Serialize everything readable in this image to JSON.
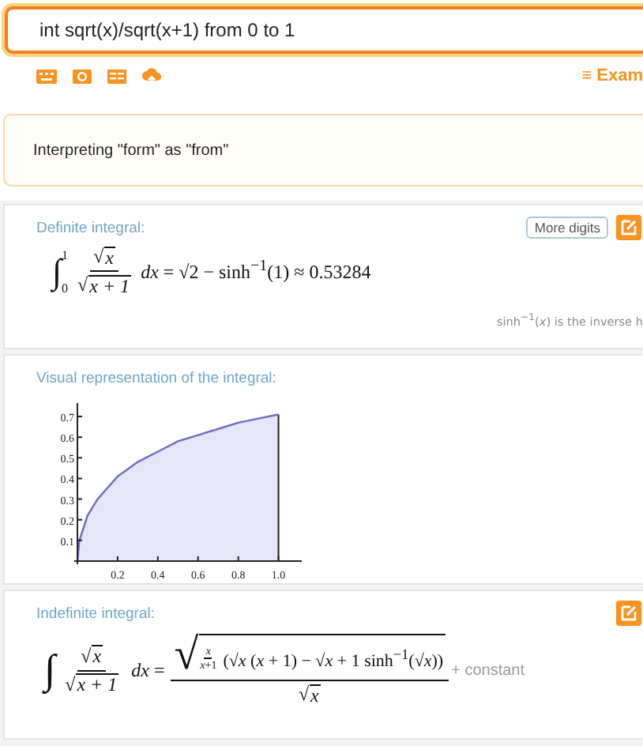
{
  "search": {
    "value": "int sqrt(x)/sqrt(x+1) from 0 to 1"
  },
  "toolbar": {
    "examples_icon": "≡",
    "examples_link": "Exam"
  },
  "notice": {
    "text": "Interpreting \"form\" as \"from\""
  },
  "definite": {
    "title": "Definite integral:",
    "more_digits_button": "More digits",
    "integral_sign": "∫",
    "upper_limit": "1",
    "lower_limit": "0",
    "radical": "√",
    "numerator": "x",
    "denominator": "x + 1",
    "result": "*dx* = √2 − sinh$^{−1}$(1) ≈ 0.53284",
    "footnote": "sinh$^{−1}$(*x*) is the inverse h"
  },
  "plot": {
    "title": "Visual representation of the integral:",
    "chart_data": {
      "type": "area",
      "x": [
        0,
        0.01,
        0.05,
        0.1,
        0.2,
        0.3,
        0.4,
        0.5,
        0.6,
        0.7,
        0.8,
        0.9,
        1.0
      ],
      "series": [
        {
          "color": "#6b6bc4",
          "values": [
            0,
            0.1,
            0.22,
            0.3,
            0.41,
            0.48,
            0.53,
            0.58,
            0.61,
            0.64,
            0.67,
            0.69,
            0.71
          ]
        }
      ],
      "xlim": [
        0,
        1.1
      ],
      "ylim": [
        0,
        0.75
      ],
      "xticks": [
        0.2,
        0.4,
        0.6,
        0.8,
        {
          "value": 1,
          "label": "1.0"
        }
      ],
      "yticks": [
        0.1,
        0.2,
        0.3,
        0.4,
        0.5,
        0.6,
        0.7
      ]
    }
  },
  "indefinite": {
    "title": "Indefinite integral:",
    "integral_sign": "∫",
    "radical": "√",
    "numerator": "x",
    "denominator": "x + 1",
    "equals": "*dx* =",
    "inner_numerator": "*x*",
    "inner_denominator": "*x*+1",
    "rest": "(√*x* (*x* + 1) − √*x* + 1 sinh$^{−1}$(√*x*))",
    "result_denominator": "x",
    "constant": "+ constant"
  }
}
